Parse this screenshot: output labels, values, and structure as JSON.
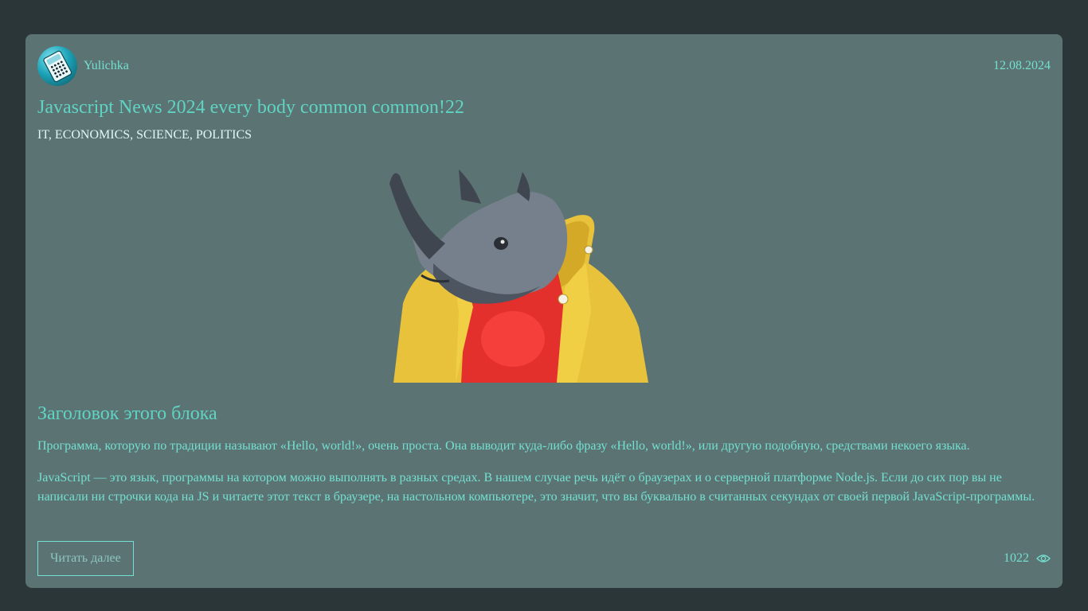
{
  "post": {
    "author": "Yulichka",
    "date": "12.08.2024",
    "title": "Javascript News 2024 every body common common!22",
    "tags": "IT, ECONOMICS, SCIENCE, POLITICS",
    "block_heading": "Заголовок этого блока",
    "paragraphs": [
      "Программа, которую по традиции называют «Hello, world!», очень проста. Она выводит куда-либо фразу «Hello, world!», или другую подобную, средствами некоего языка.",
      "JavaScript — это язык, программы на котором можно выполнять в разных средах. В нашем случае речь идёт о браузерах и о серверной платформе Node.js. Если до сих пор вы не написали ни строчки кода на JS и читаете этот текст в браузере, на настольном компьютере, это значит, что вы буквально в считанных секундах от своей первой JavaScript-программы."
    ],
    "read_more_label": "Читать далее",
    "views": "1022"
  },
  "icons": {
    "avatar": "calculator-phone-avatar",
    "views": "eye-icon",
    "image": "rhino-in-yellow-jacket"
  },
  "colors": {
    "page_bg": "#2b3638",
    "card_bg": "#5c7373",
    "accent": "#5fd4c4"
  }
}
